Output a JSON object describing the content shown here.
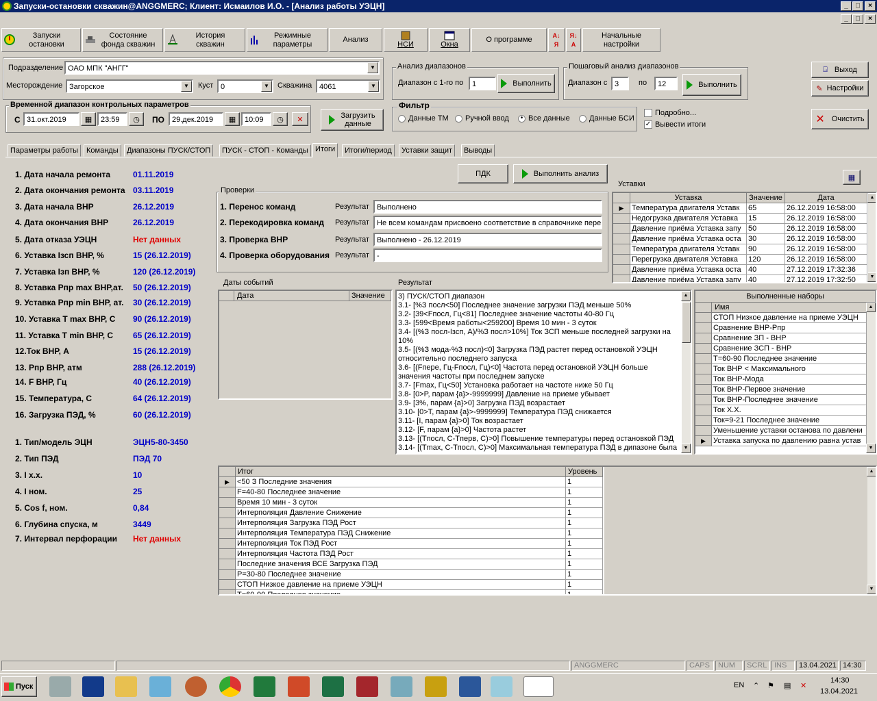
{
  "window": {
    "title": "Запуски-остановки скважин@ANGGMERC;  Клиент: Исмаилов И.О. - [Анализ работы УЭЦН]"
  },
  "toolbar": {
    "buttons": [
      {
        "label": "Запуски\nостановки"
      },
      {
        "label": "Состояние\nфонда скважин"
      },
      {
        "label": "История\nскважин"
      },
      {
        "label": "Режимные\nпараметры"
      },
      {
        "label": "Анализ"
      },
      {
        "label": "НСИ"
      },
      {
        "label": "Окна"
      },
      {
        "label": "О программе"
      },
      {
        "label": "Начальные\nнастройки"
      }
    ]
  },
  "filters": {
    "subdivision_label": "Подразделение",
    "subdivision_value": "ОАО МПК \"АНГГ\"",
    "field_label": "Месторождение",
    "field_value": "Загорское",
    "cluster_label": "Куст",
    "cluster_value": "0",
    "well_label": "Скважина",
    "well_value": "4061"
  },
  "time_range": {
    "title": "Временной диапазон контрольных параметров",
    "from_label": "С",
    "from_date": "31.окт.2019",
    "from_time": "23:59",
    "to_label": "ПО",
    "to_date": "29.дек.2019",
    "to_time": "10:09",
    "load_button": "Загрузить\nданные"
  },
  "range_analysis": {
    "title": "Анализ диапазонов",
    "label": "Диапазон с 1-го по",
    "value": "1",
    "run": "Выполнить"
  },
  "step_analysis": {
    "title": "Пошаговый анализ диапазонов",
    "label": "Диапазон с",
    "from": "3",
    "to_label": "по",
    "to": "12",
    "run": "Выполнить"
  },
  "filter": {
    "title": "Фильтр",
    "options": [
      "Данные ТМ",
      "Ручной ввод",
      "Все данные",
      "Данные БСИ"
    ],
    "selected": "Все данные"
  },
  "checkboxes": {
    "detailed": "Подробно...",
    "detailed_checked": false,
    "totals": "Вывести итоги",
    "totals_checked": true
  },
  "side_buttons": {
    "exit": "Выход",
    "settings": "Настройки",
    "clear": "Очистить"
  },
  "tabs": [
    "Параметры работы",
    "Команды",
    "Диапазоны ПУСК/СТОП",
    "ПУСК - СТОП - Команды",
    "Итоги",
    "Итоги/период",
    "Уставки защит",
    "Выводы"
  ],
  "active_tab": "Итоги",
  "summary": [
    {
      "label": "1. Дата начала ремонта",
      "value": "01.11.2019",
      "red": false
    },
    {
      "label": "2. Дата окончания ремонта",
      "value": "03.11.2019",
      "red": false
    },
    {
      "label": "3. Дата начала ВНР",
      "value": "26.12.2019",
      "red": false
    },
    {
      "label": "4. Дата окончания ВНР",
      "value": "26.12.2019",
      "red": false
    },
    {
      "label": "5. Дата отказа УЭЦН",
      "value": "Нет данных",
      "red": true
    },
    {
      "label": "6. Уставка Iзсп ВНР, %",
      "value": "15 (26.12.2019)",
      "red": false
    },
    {
      "label": "7. Уставка Iзп ВНР, %",
      "value": "120 (26.12.2019)",
      "red": false
    },
    {
      "label": "8. Уставка Pпр max ВНР,ат.",
      "value": "50 (26.12.2019)",
      "red": false
    },
    {
      "label": "9. Уставка Pпр min ВНР, ат.",
      "value": "30 (26.12.2019)",
      "red": false
    },
    {
      "label": "10. Уставка T max ВНР, C",
      "value": "90 (26.12.2019)",
      "red": false
    },
    {
      "label": "11. Уставка T min ВНР, C",
      "value": "65 (26.12.2019)",
      "red": false
    },
    {
      "label": "12.Ток ВНР, А",
      "value": "15 (26.12.2019)",
      "red": false
    },
    {
      "label": "13. Pпр ВНР, атм",
      "value": "288 (26.12.2019)",
      "red": false
    },
    {
      "label": "14. F ВНР, Гц",
      "value": "40 (26.12.2019)",
      "red": false
    },
    {
      "label": "15. Температура, C",
      "value": "64 (26.12.2019)",
      "red": false
    },
    {
      "label": "16. Загрузка ПЭД, %",
      "value": "60 (26.12.2019)",
      "red": false
    }
  ],
  "equipment": [
    {
      "label": "1. Тип/модель ЭЦН",
      "value": "ЭЦН5-80-3450",
      "red": false
    },
    {
      "label": "2. Тип ПЭД",
      "value": "ПЭД 70",
      "red": false
    },
    {
      "label": "3. I х.х.",
      "value": "10",
      "red": false
    },
    {
      "label": "4. I ном.",
      "value": "25",
      "red": false
    },
    {
      "label": "5. Cos f, ном.",
      "value": "0,84",
      "red": false
    },
    {
      "label": "6. Глубина спуска, м",
      "value": "3449",
      "red": false
    },
    {
      "label": "7. Интервал перфорации",
      "value": "Нет данных",
      "red": true
    }
  ],
  "actions": {
    "pdk": "ПДК",
    "run_analysis": "Выполнить анализ"
  },
  "checks": {
    "title": "Проверки",
    "result_label": "Результат",
    "items": [
      {
        "label": "1. Перенос команд",
        "result": "Выполнено"
      },
      {
        "label": "2. Перекодировка команд",
        "result": "Не всем командам присвоено соответствие в справочнике пере"
      },
      {
        "label": "3. Проверка ВНР",
        "result": "Выполнено - 26.12.2019"
      },
      {
        "label": "4. Проверка оборудования",
        "result": "-"
      }
    ]
  },
  "ustavki": {
    "title": "Уставки",
    "headers": [
      "Уставка",
      "Значение",
      "Дата"
    ],
    "rows": [
      [
        "Температура двигателя Уставк",
        "65",
        "26.12.2019 16:58:00"
      ],
      [
        "Недогрузка двигателя Уставка",
        "15",
        "26.12.2019 16:58:00"
      ],
      [
        "Давление приёма Уставка запу",
        "50",
        "26.12.2019 16:58:00"
      ],
      [
        "Давление приёма Уставка оста",
        "30",
        "26.12.2019 16:58:00"
      ],
      [
        "Температура двигателя Уставк",
        "90",
        "26.12.2019 16:58:00"
      ],
      [
        "Перегрузка двигателя Уставка",
        "120",
        "26.12.2019 16:58:00"
      ],
      [
        "Давление приёма Уставка оста",
        "40",
        "27.12.2019 17:32:36"
      ],
      [
        "Давление приёма Уставка запу",
        "40",
        "27.12.2019 17:32:50"
      ]
    ]
  },
  "events": {
    "title": "Даты событий",
    "headers": [
      "Дата",
      "Значение"
    ]
  },
  "result": {
    "title": "Результат",
    "lines": [
      "3) ПУСК/СТОП диапазон",
      "3.1- [%З посл<50] Последнее значение загрузки ПЭД меньше 50%",
      "3.2- [39<Fпосл, Гц<81] Последнее значение частоты 40-80 Гц",
      "3.3- [599<Время работы<259200] Время 10 мин - 3 суток",
      "3.4- [(%З посл-Iзсп, А)/%З посл>10%] Ток ЗСП меньше последней загрузки на 10%",
      "3.5- [(%З мода-%З посл)<0] Загрузка ПЭД растет перед остановкой УЭЦН относительно последнего запуска",
      "3.6- [(Fпере, Гц-Fпосл, Гц)<0] Частота перед остановкой УЭЦН больше значения частоты при последнем запуске",
      "3.7- [Fmax, Гц<50] Установка работает на частоте ниже 50 Гц",
      "3.8- [0>P, парам {a}>-9999999] Давление на приеме убывает",
      "3.9- [3%, парам {a}>0] Загрузка ПЭД возрастает",
      "3.10- [0>T, парам {a}>-9999999] Температура ПЭД снижается",
      "3.11- [I, парам {a}>0] Ток возрастает",
      "3.12- [F, парам {a}>0] Частота растет",
      "3.13- [(Tпосл, С-Tперв, С)>0] Повышение температуры перед остановкой ПЭД",
      "3.14- [(Tmax, С-Tпосл, С)>0] Максимальная температура ПЭД в дипазоне была"
    ]
  },
  "sets": {
    "title": "Выполненные наборы",
    "header": "Имя",
    "rows": [
      "СТОП Низкое давление на приеме УЭЦН",
      "Сравнение ВНР-Рпр",
      "Сравнение ЗП - ВНР",
      "Сравнение ЗСП - ВНР",
      "T=60-90 Последнее значение",
      "Ток ВНР < Максимального",
      "Ток ВНР-Мода",
      "Ток ВНР-Первое значение",
      "Ток ВНР-Последнее значение",
      "Ток Х.Х.",
      "Ток=9-21 Последнее значение",
      "Уменьшение уставки останова по давлени",
      "Уставка запуска по давлению равна устав"
    ]
  },
  "totals": {
    "headers": [
      "Итог",
      "Уровень"
    ],
    "rows": [
      [
        "<50 З Последние значения",
        "1"
      ],
      [
        "F=40-80 Последнее значение",
        "1"
      ],
      [
        "Время 10 мин - 3 суток",
        "1"
      ],
      [
        "Интерполяция Давление Снижение",
        "1"
      ],
      [
        "Интерполяция Загрузка ПЭД Рост",
        "1"
      ],
      [
        "Интерполяция Температура ПЭД Снижение",
        "1"
      ],
      [
        "Интерполяция Ток ПЭД Рост",
        "1"
      ],
      [
        "Интерполяция Частота ПЭД Рост",
        "1"
      ],
      [
        "Последние значения ВСЕ Загрузка ПЭД",
        "1"
      ],
      [
        "P=30-80 Последнее значение",
        "1"
      ],
      [
        "СТОП Низкое давление на приеме УЭЦН",
        "1"
      ],
      [
        "T=60-90 Последнее значение",
        "1"
      ]
    ]
  },
  "statusbar": {
    "server": "ANGGMERC",
    "caps": "CAPS",
    "num": "NUM",
    "scrl": "SCRL",
    "ins": "INS",
    "date": "13.04.2021",
    "time": "14:30"
  },
  "taskbar": {
    "start": "Пуск",
    "lang": "EN",
    "clock_time": "14:30",
    "clock_date": "13.04.2021"
  }
}
